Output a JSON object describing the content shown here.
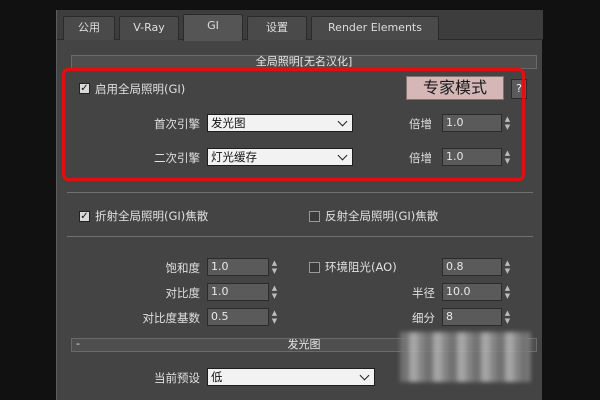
{
  "tabs": [
    {
      "label": "公用",
      "active": false
    },
    {
      "label": "V-Ray",
      "active": false
    },
    {
      "label": "GI",
      "active": true
    },
    {
      "label": "设置",
      "active": false
    },
    {
      "label": "Render Elements",
      "active": false
    }
  ],
  "gi_rollout": {
    "title": "全局照明[无名汉化]",
    "enable_gi": {
      "label": "启用全局照明(GI)",
      "checked": true
    },
    "expert_mode_label": "专家模式",
    "help_label": "?",
    "primary_engine": {
      "label": "首次引擎",
      "value": "发光图"
    },
    "primary_multiplier": {
      "label": "倍增",
      "value": "1.0"
    },
    "secondary_engine": {
      "label": "二次引擎",
      "value": "灯光缓存"
    },
    "secondary_multiplier": {
      "label": "倍增",
      "value": "1.0"
    },
    "refractive_caustics": {
      "label": "折射全局照明(GI)焦散",
      "checked": true
    },
    "reflective_caustics": {
      "label": "反射全局照明(GI)焦散",
      "checked": false
    },
    "saturation": {
      "label": "饱和度",
      "value": "1.0"
    },
    "contrast": {
      "label": "对比度",
      "value": "1.0"
    },
    "contrast_base": {
      "label": "对比度基数",
      "value": "0.5"
    },
    "ambient_occlusion": {
      "label": "环境阻光(AO)",
      "checked": false,
      "value": "0.8"
    },
    "radius": {
      "label": "半径",
      "value": "10.0"
    },
    "subdivs": {
      "label": "细分",
      "value": "8"
    }
  },
  "irradiance_rollout": {
    "title": "发光图",
    "collapse_symbol": "-",
    "current_preset": {
      "label": "当前预设",
      "value": "低"
    }
  },
  "colors": {
    "highlight_box": "#e01010",
    "expert_button": "#d5b7b7",
    "panel_bg": "#444444"
  }
}
